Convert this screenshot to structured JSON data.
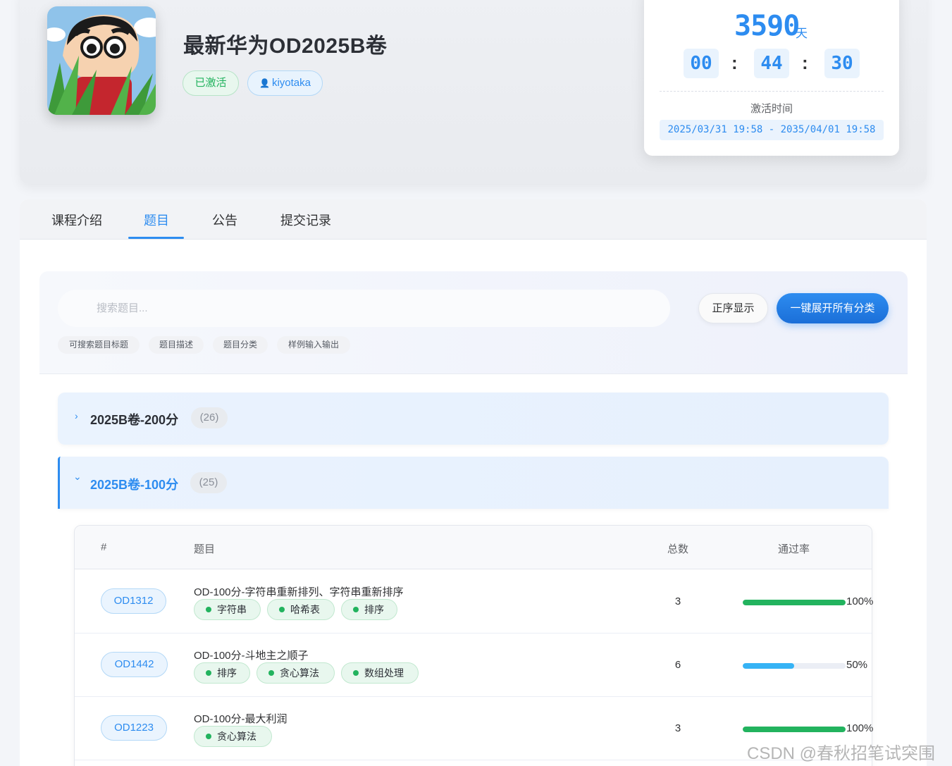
{
  "course": {
    "title": "最新华为OD2025B卷",
    "status_badge": "已激活",
    "user": "kiyotaka"
  },
  "countdown": {
    "days": "3590",
    "days_unit": "天",
    "hours": "00",
    "minutes": "44",
    "seconds": "30",
    "separator": ":",
    "activate_label": "激活时间",
    "activate_range": "2025/03/31 19:58 - 2035/04/01 19:58"
  },
  "tabs": [
    {
      "label": "课程介绍"
    },
    {
      "label": "题目",
      "active": true
    },
    {
      "label": "公告"
    },
    {
      "label": "提交记录"
    }
  ],
  "search": {
    "placeholder": "搜索题目...",
    "order_button": "正序显示",
    "expand_button": "一键展开所有分类",
    "hints": [
      "可搜索题目标题",
      "题目描述",
      "题目分类",
      "样例输入输出"
    ]
  },
  "categories": [
    {
      "title": "2025B卷-200分",
      "count": "(26)",
      "chevron": "›",
      "expanded": false
    },
    {
      "title": "2025B卷-100分",
      "count": "(25)",
      "chevron": "⌄",
      "expanded": true
    }
  ],
  "table": {
    "headers": [
      "#",
      "题目",
      "总数",
      "通过率"
    ],
    "rows": [
      {
        "id": "OD1312",
        "title": "OD-100分-字符串重新排列、字符串重新排序",
        "tags": [
          "字符串",
          "哈希表",
          "排序"
        ],
        "total": "3",
        "rate": "100%",
        "rate_value": 1.0
      },
      {
        "id": "OD1442",
        "title": "OD-100分-斗地主之顺子",
        "tags": [
          "排序",
          "贪心算法",
          "数组处理"
        ],
        "total": "6",
        "rate": "50%",
        "rate_value": 0.5
      },
      {
        "id": "OD1223",
        "title": "OD-100分-最大利润",
        "tags": [
          "贪心算法"
        ],
        "total": "3",
        "rate": "100%",
        "rate_value": 1.0
      }
    ]
  },
  "colors": {
    "accent": "#2d8cf0",
    "success": "#22b35e",
    "partial": "#36b3f5"
  },
  "watermark": "CSDN @春秋招笔试突围"
}
